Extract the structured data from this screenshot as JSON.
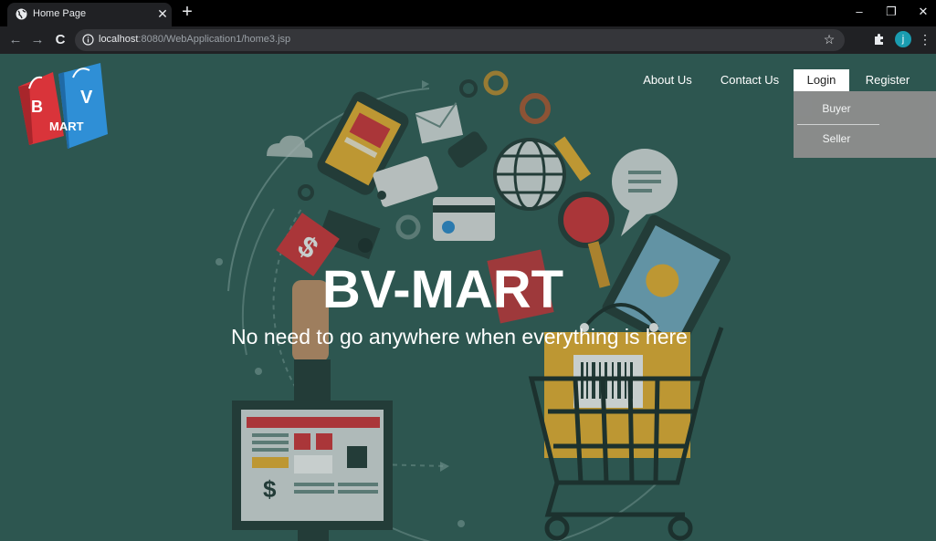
{
  "browser": {
    "tab_title": "Home Page",
    "tab_close": "✕",
    "new_tab": "+",
    "url_host": "localhost",
    "url_rest": ":8080/WebApplication1/home3.jsp",
    "profile_initial": "j",
    "window_controls": {
      "minimize": "–",
      "restore": "❐",
      "close": "✕"
    },
    "nav": {
      "back": "←",
      "forward": "→",
      "reload": "C"
    },
    "star": "☆",
    "menu": "⋮"
  },
  "logo": {
    "letters": [
      "B",
      "V"
    ],
    "text": "MART"
  },
  "nav": {
    "about": "About Us",
    "contact": "Contact Us",
    "login": "Login",
    "register": "Register"
  },
  "dropdown": {
    "buyer": "Buyer",
    "seller": "Seller"
  },
  "hero": {
    "title": "BV-MART",
    "subtitle": "No need to go anywhere when everything is here"
  },
  "colors": {
    "background": "#325f58",
    "accent_red": "#d9343a",
    "accent_blue": "#2f8fd6",
    "accent_yellow": "#f2b632"
  }
}
